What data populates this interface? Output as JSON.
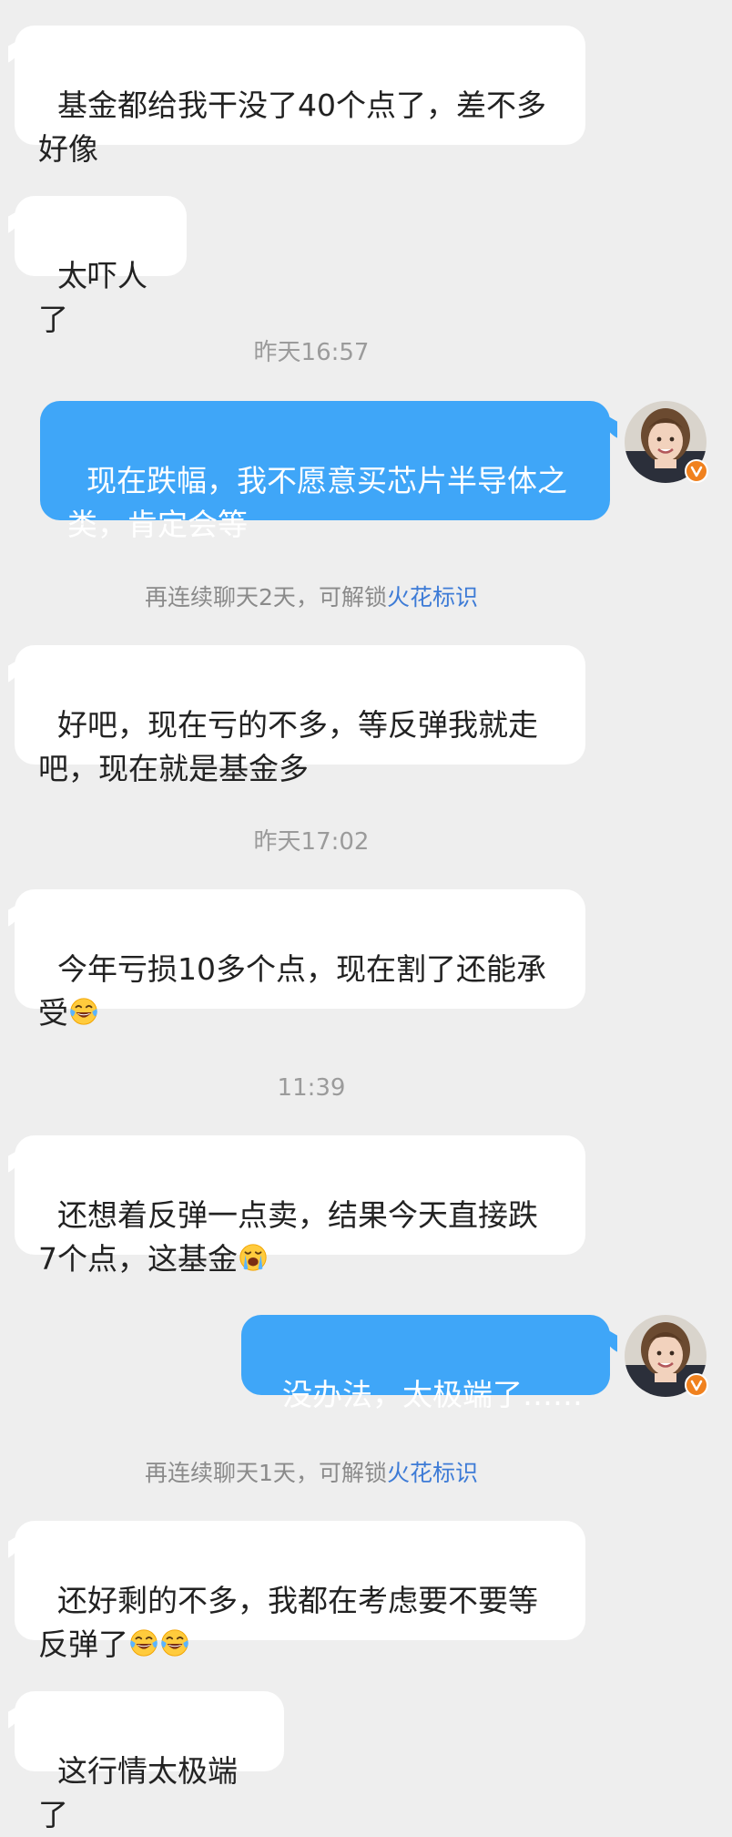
{
  "conversation": {
    "msg1": "基金都给我干没了40个点了，差不多\n好像",
    "msg2": "太吓人了",
    "ts1": "昨天16:57",
    "msg3": "现在跌幅，我不愿意买芯片半导体之\n类，肯定会等",
    "hint1": {
      "text": "再连续聊天2天，可解锁",
      "link": "火花标识"
    },
    "msg4": "好吧，现在亏的不多，等反弹我就走\n吧，现在就是基金多",
    "ts2": "昨天17:02",
    "msg5": "今年亏损10多个点，现在割了还能承\n受",
    "ts3": "11:39",
    "msg6a": "还想着反弹一点卖，结果今天直接跌\n7个点，这基金",
    "msg7": "没办法，太极端了……",
    "hint2": {
      "text": "再连续聊天1天，可解锁",
      "link": "火花标识"
    },
    "msg8": "还好剩的不多，我都在考虑要不要等\n反弹了",
    "msg9": "这行情太极端了"
  },
  "icons": {
    "laugh_cry": "face-with-tears-of-joy-icon",
    "crying": "loudly-crying-face-icon",
    "verified_badge": "v-badge-icon"
  },
  "colors": {
    "background": "#eeeeee",
    "incoming_bubble": "#ffffff",
    "outgoing_bubble": "#3fa6f8",
    "link": "#3d7bd6",
    "badge": "#f0811e"
  }
}
